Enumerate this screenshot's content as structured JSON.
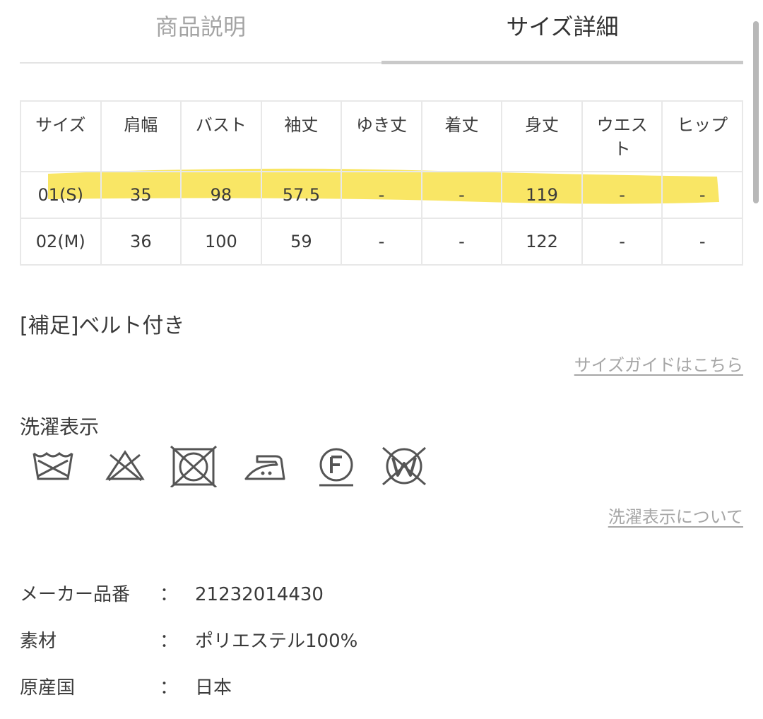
{
  "tabs": [
    {
      "label": "商品説明",
      "active": false
    },
    {
      "label": "サイズ詳細",
      "active": true
    }
  ],
  "size_table": {
    "headers": [
      "サイズ",
      "肩幅",
      "バスト",
      "袖丈",
      "ゆき丈",
      "着丈",
      "身丈",
      "ウエスト",
      "ヒップ"
    ],
    "rows": [
      [
        "01(S)",
        "35",
        "98",
        "57.5",
        "-",
        "-",
        "119",
        "-",
        "-"
      ],
      [
        "02(M)",
        "36",
        "100",
        "59",
        "-",
        "-",
        "122",
        "-",
        "-"
      ]
    ],
    "highlighted_row": 0,
    "highlight_color": "#f8e24a"
  },
  "note": "[補足]ベルト付き",
  "size_guide_link": "サイズガイドはこちら",
  "care": {
    "label": "洗濯表示",
    "icons": [
      "hand-wash-icon",
      "no-bleach-icon",
      "no-tumble-dry-icon",
      "iron-low-icon",
      "dry-clean-f-icon",
      "no-wet-clean-icon"
    ],
    "about_link": "洗濯表示について"
  },
  "specs": [
    {
      "label": "メーカー品番",
      "sep": "：",
      "value": "21232014430"
    },
    {
      "label": "素材",
      "sep": "：",
      "value": "ポリエステル100%"
    },
    {
      "label": "原産国",
      "sep": "：",
      "value": "日本"
    }
  ],
  "colors": {
    "text": "#3a3a3a",
    "muted": "#a4a4a4",
    "border": "#e8e8e8"
  }
}
